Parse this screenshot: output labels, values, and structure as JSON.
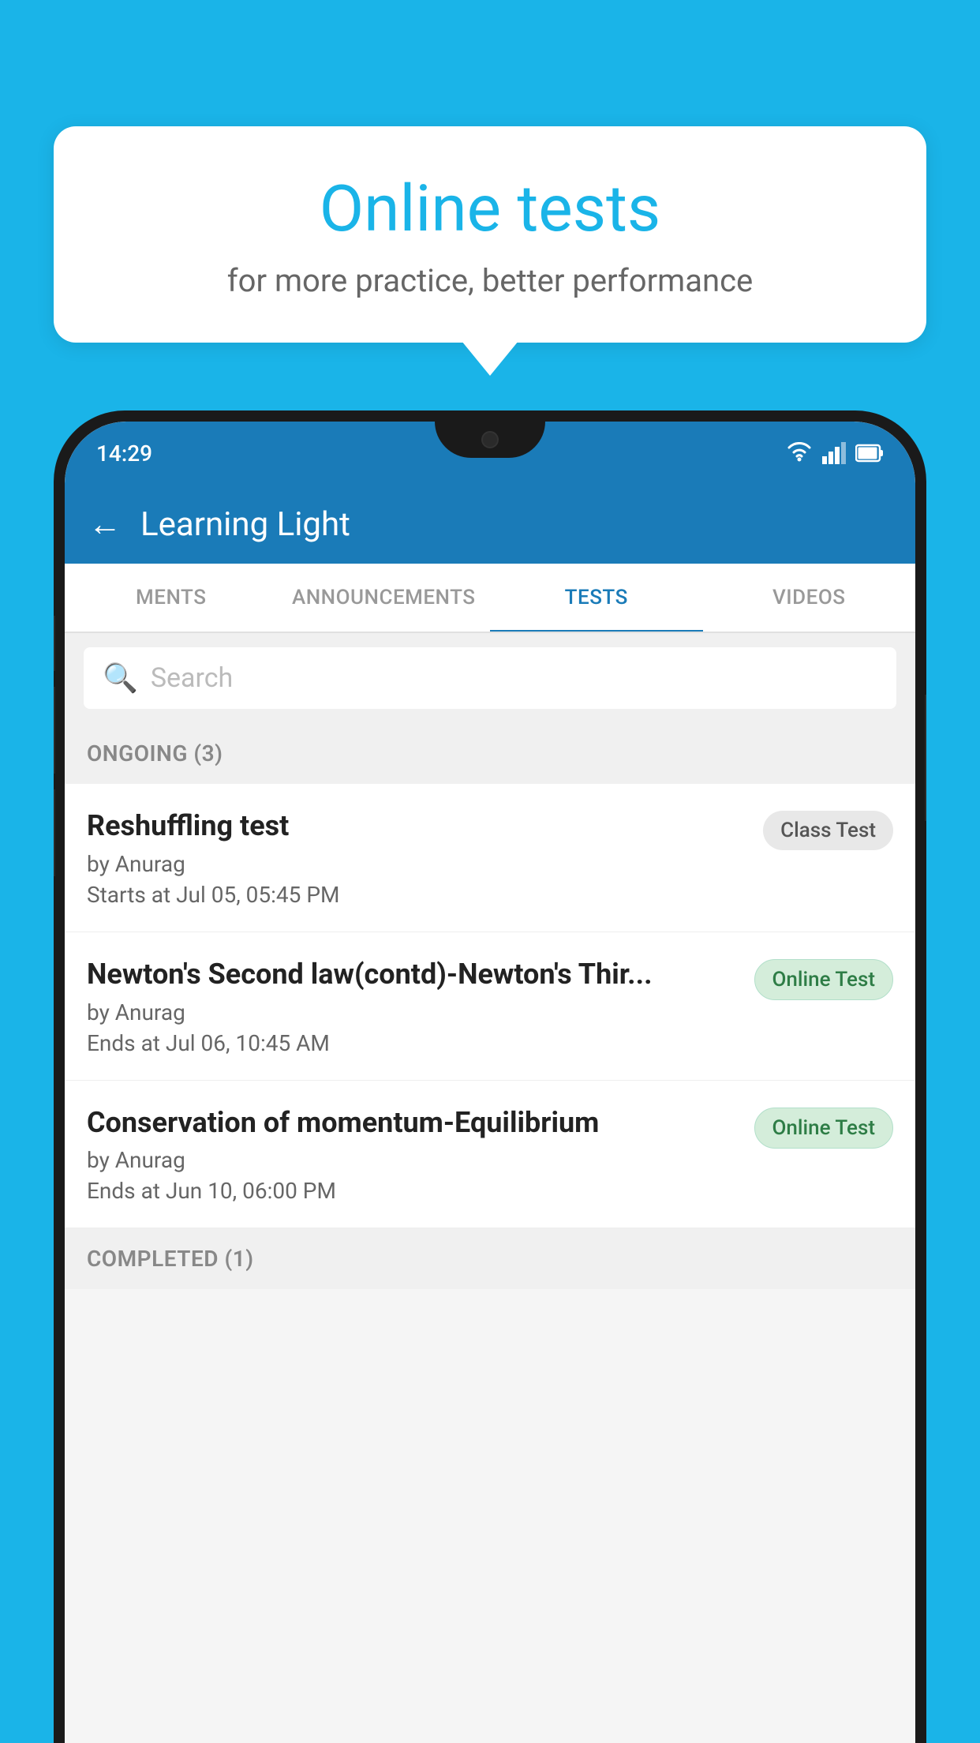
{
  "background_color": "#1ab4e8",
  "bubble": {
    "title": "Online tests",
    "subtitle": "for more practice, better performance"
  },
  "phone": {
    "status_bar": {
      "time": "14:29",
      "icons": [
        "wifi",
        "signal",
        "battery"
      ]
    },
    "app_bar": {
      "title": "Learning Light",
      "back_label": "←"
    },
    "tabs": [
      {
        "label": "MENTS",
        "active": false
      },
      {
        "label": "ANNOUNCEMENTS",
        "active": false
      },
      {
        "label": "TESTS",
        "active": true
      },
      {
        "label": "VIDEOS",
        "active": false
      }
    ],
    "search": {
      "placeholder": "Search"
    },
    "section_ongoing": {
      "label": "ONGOING (3)"
    },
    "tests": [
      {
        "title": "Reshuffling test",
        "author": "by Anurag",
        "date": "Starts at  Jul 05, 05:45 PM",
        "badge": "Class Test",
        "badge_type": "class"
      },
      {
        "title": "Newton's Second law(contd)-Newton's Thir...",
        "author": "by Anurag",
        "date": "Ends at  Jul 06, 10:45 AM",
        "badge": "Online Test",
        "badge_type": "online"
      },
      {
        "title": "Conservation of momentum-Equilibrium",
        "author": "by Anurag",
        "date": "Ends at  Jun 10, 06:00 PM",
        "badge": "Online Test",
        "badge_type": "online"
      }
    ],
    "section_completed": {
      "label": "COMPLETED (1)"
    }
  }
}
